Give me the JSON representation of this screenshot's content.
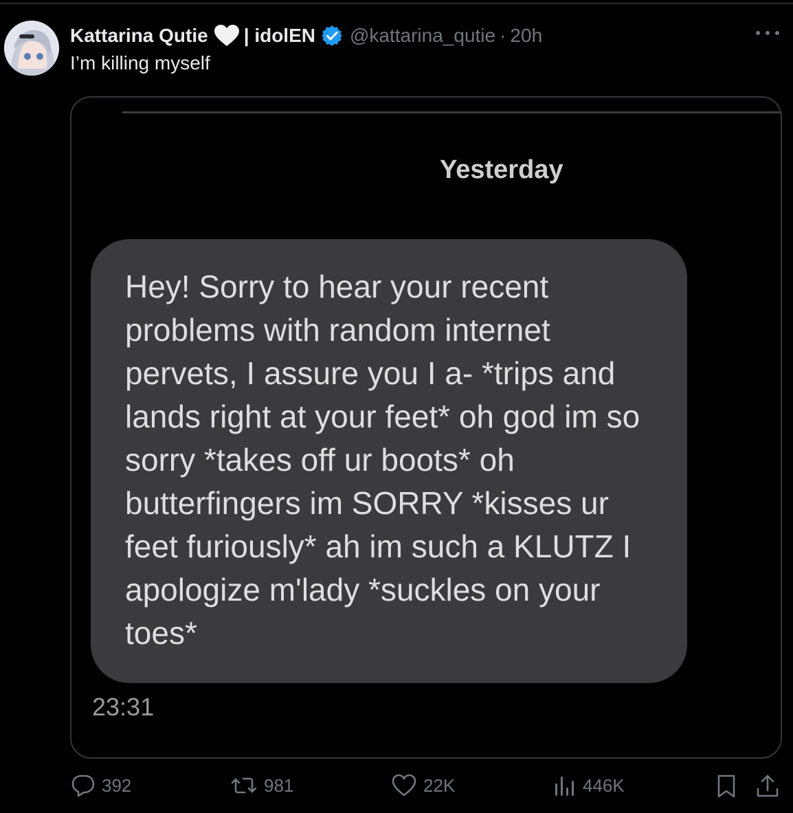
{
  "post": {
    "author": {
      "display_name": "Kattarina Qutie",
      "name_suffix": "| idolEN",
      "handle": "@kattarina_qutie",
      "separator": "·",
      "time": "20h"
    },
    "text": "I’m killing myself"
  },
  "screenshot": {
    "date_label": "Yesterday",
    "message": "Hey! Sorry to hear your recent problems with random internet pervets, I assure you I a- *trips and lands right at your feet* oh god im so sorry *takes off ur boots* oh butterfingers im SORRY *kisses ur feet furiously* ah im such a KLUTZ I apologize m'lady *suckles on your toes*",
    "message_time": "23:31"
  },
  "actions": {
    "replies": "392",
    "reposts": "981",
    "likes": "22K",
    "views": "446K"
  },
  "icons": {
    "verified": "verified-badge-icon",
    "heart": "white-heart-icon",
    "more": "more-icon",
    "reply": "reply-icon",
    "repost": "repost-icon",
    "like": "like-icon",
    "views": "views-icon",
    "bookmark": "bookmark-icon",
    "share": "share-icon"
  },
  "colors": {
    "background": "#000000",
    "text": "#e7e9ea",
    "muted": "#71767b",
    "verified": "#1d9bf0",
    "bubble": "#3b3b3d"
  }
}
